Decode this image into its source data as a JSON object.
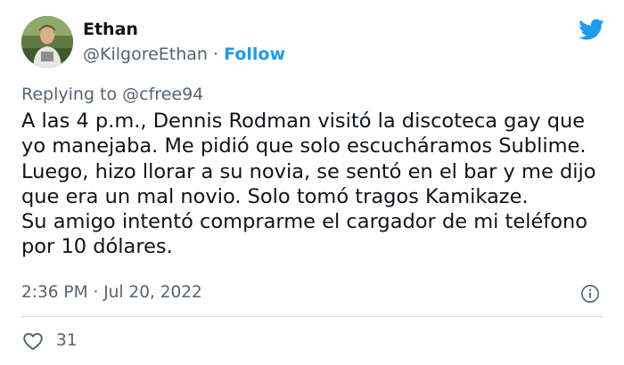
{
  "author": {
    "name": "Ethan",
    "handle": "@KilgoreEthan",
    "separator": "·",
    "follow_label": "Follow"
  },
  "platform_icon": "twitter-bird-icon",
  "accent_color": "#1d9bf0",
  "replying": {
    "prefix": "Replying to",
    "mention": "@cfree94"
  },
  "tweet": {
    "lines": [
      "A las 4 p.m., Dennis Rodman visitó la discoteca gay que",
      "yo manejaba. Me pidió que solo escucháramos Sublime.",
      "Luego, hizo llorar a su novia, se sentó en el bar y me dijo",
      "que era un mal novio. Solo tomó tragos Kamikaze.",
      "Su amigo intentó comprarme el cargador de mi teléfono",
      "por 10 dólares."
    ]
  },
  "meta": {
    "time": "2:36 PM",
    "separator": "·",
    "date": "Jul 20, 2022"
  },
  "info_icon": "info-icon",
  "engagement": {
    "like_icon": "heart-icon",
    "likes": "31"
  }
}
